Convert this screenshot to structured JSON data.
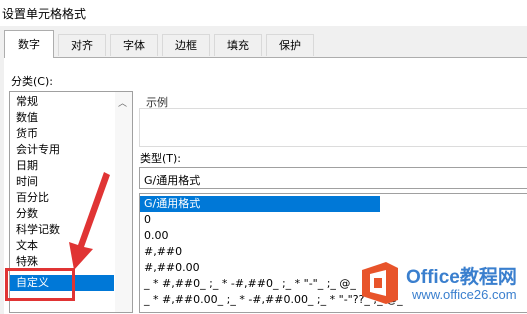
{
  "window": {
    "title": "设置单元格格式"
  },
  "tabs": [
    {
      "label": "数字",
      "active": true
    },
    {
      "label": "对齐"
    },
    {
      "label": "字体"
    },
    {
      "label": "边框"
    },
    {
      "label": "填充"
    },
    {
      "label": "保护"
    }
  ],
  "category": {
    "label": "分类(C):",
    "items": [
      "常规",
      "数值",
      "货币",
      "会计专用",
      "日期",
      "时间",
      "百分比",
      "分数",
      "科学记数",
      "文本",
      "特殊",
      "自定义"
    ],
    "selected": "自定义"
  },
  "sample": {
    "label": "示例"
  },
  "type": {
    "label": "类型(T):",
    "value": "G/通用格式",
    "formats": [
      "G/通用格式",
      "0",
      "0.00",
      "#,##0",
      "#,##0.00",
      "_ * #,##0_ ;_ * -#,##0_ ;_ * \"-\"_ ;_ @_",
      "_ * #,##0.00_ ;_ * -#,##0.00_ ;_ * \"-\"??_ ;_ @_"
    ]
  },
  "watermark": {
    "brand": "Office教程网",
    "url": "www.office26.com"
  },
  "colors": {
    "selection": "#0078d7",
    "annotation": "#e03434",
    "brand": "#3a7fce"
  }
}
